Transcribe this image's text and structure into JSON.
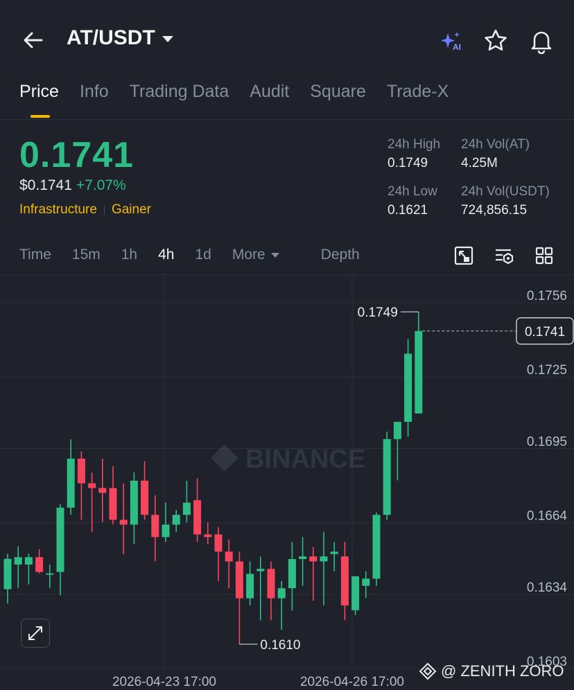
{
  "header": {
    "pair": "AT/USDT",
    "icons": [
      "back-arrow-icon",
      "ai-sparkle-icon",
      "star-icon",
      "bell-icon"
    ]
  },
  "tabs": [
    {
      "label": "Price",
      "active": true
    },
    {
      "label": "Info",
      "active": false
    },
    {
      "label": "Trading Data",
      "active": false
    },
    {
      "label": "Audit",
      "active": false
    },
    {
      "label": "Square",
      "active": false
    },
    {
      "label": "Trade-X",
      "active": false
    }
  ],
  "price": {
    "last": "0.1741",
    "usd": "$0.1741",
    "change": "+7.07%",
    "tags": [
      "Infrastructure",
      "Gainer"
    ]
  },
  "stats": {
    "high_label": "24h High",
    "high": "0.1749",
    "low_label": "24h Low",
    "low": "0.1621",
    "vol_base_label": "24h Vol(AT)",
    "vol_base": "4.25M",
    "vol_quote_label": "24h Vol(USDT)",
    "vol_quote": "724,856.15"
  },
  "intervals": {
    "items": [
      "Time",
      "15m",
      "1h",
      "4h",
      "1d"
    ],
    "active": "4h",
    "more": "More",
    "depth": "Depth"
  },
  "chart_data": {
    "type": "candlestick",
    "interval": "4h",
    "watermark": "BINANCE",
    "y_ticks": [
      "0.1756",
      "0.1725",
      "0.1695",
      "0.1664",
      "0.1634",
      "0.1603"
    ],
    "x_ticks": [
      "2026-04-23 17:00",
      "2026-04-26 17:00"
    ],
    "last_price": "0.1741",
    "max_label": "0.1749",
    "min_label": "0.1610",
    "colors": {
      "up": "#2ebd85",
      "down": "#f6465d",
      "grid": "#2b2f36",
      "text": "#b7bdc6"
    },
    "candles": [
      {
        "o": 0.1633,
        "h": 0.16478,
        "l": 0.1627,
        "c": 0.16457
      },
      {
        "o": 0.16433,
        "h": 0.16509,
        "l": 0.16335,
        "c": 0.16464
      },
      {
        "o": 0.16433,
        "h": 0.16478,
        "l": 0.1635,
        "c": 0.16464
      },
      {
        "o": 0.16464,
        "h": 0.16498,
        "l": 0.16396,
        "c": 0.16402
      },
      {
        "o": 0.16396,
        "h": 0.16433,
        "l": 0.16335,
        "c": 0.16396
      },
      {
        "o": 0.16402,
        "h": 0.16685,
        "l": 0.16305,
        "c": 0.16671
      },
      {
        "o": 0.16671,
        "h": 0.16957,
        "l": 0.16641,
        "c": 0.16876
      },
      {
        "o": 0.16876,
        "h": 0.16906,
        "l": 0.1662,
        "c": 0.16773
      },
      {
        "o": 0.16773,
        "h": 0.16818,
        "l": 0.16569,
        "c": 0.16753
      },
      {
        "o": 0.16753,
        "h": 0.16876,
        "l": 0.1661,
        "c": 0.16733
      },
      {
        "o": 0.16753,
        "h": 0.16845,
        "l": 0.166,
        "c": 0.1662
      },
      {
        "o": 0.1662,
        "h": 0.16773,
        "l": 0.16476,
        "c": 0.166
      },
      {
        "o": 0.166,
        "h": 0.16819,
        "l": 0.16518,
        "c": 0.16784
      },
      {
        "o": 0.16784,
        "h": 0.16866,
        "l": 0.1662,
        "c": 0.16641
      },
      {
        "o": 0.16641,
        "h": 0.16723,
        "l": 0.16447,
        "c": 0.16548
      },
      {
        "o": 0.16548,
        "h": 0.16692,
        "l": 0.16528,
        "c": 0.166
      },
      {
        "o": 0.166,
        "h": 0.16661,
        "l": 0.1657,
        "c": 0.16641
      },
      {
        "o": 0.16641,
        "h": 0.16784,
        "l": 0.1661,
        "c": 0.16692
      },
      {
        "o": 0.16702,
        "h": 0.16794,
        "l": 0.16528,
        "c": 0.16559
      },
      {
        "o": 0.16559,
        "h": 0.1661,
        "l": 0.16518,
        "c": 0.16548
      },
      {
        "o": 0.16559,
        "h": 0.1659,
        "l": 0.16364,
        "c": 0.16487
      },
      {
        "o": 0.16487,
        "h": 0.16538,
        "l": 0.16333,
        "c": 0.16446
      },
      {
        "o": 0.16446,
        "h": 0.16487,
        "l": 0.161,
        "c": 0.16292
      },
      {
        "o": 0.16292,
        "h": 0.16446,
        "l": 0.16262,
        "c": 0.16394
      },
      {
        "o": 0.16405,
        "h": 0.16466,
        "l": 0.162,
        "c": 0.16415
      },
      {
        "o": 0.16415,
        "h": 0.16446,
        "l": 0.162,
        "c": 0.16292
      },
      {
        "o": 0.16292,
        "h": 0.16364,
        "l": 0.1616,
        "c": 0.16334
      },
      {
        "o": 0.16334,
        "h": 0.16528,
        "l": 0.16241,
        "c": 0.16456
      },
      {
        "o": 0.16456,
        "h": 0.16548,
        "l": 0.16344,
        "c": 0.16467
      },
      {
        "o": 0.16467,
        "h": 0.16507,
        "l": 0.16282,
        "c": 0.16446
      },
      {
        "o": 0.16446,
        "h": 0.16569,
        "l": 0.16262,
        "c": 0.16467
      },
      {
        "o": 0.16477,
        "h": 0.16528,
        "l": 0.16405,
        "c": 0.16487
      },
      {
        "o": 0.16467,
        "h": 0.16528,
        "l": 0.162,
        "c": 0.16262
      },
      {
        "o": 0.16242,
        "h": 0.16384,
        "l": 0.16221,
        "c": 0.16384
      },
      {
        "o": 0.16344,
        "h": 0.16405,
        "l": 0.16293,
        "c": 0.16374
      },
      {
        "o": 0.16374,
        "h": 0.16651,
        "l": 0.16344,
        "c": 0.16641
      },
      {
        "o": 0.16641,
        "h": 0.16989,
        "l": 0.1662,
        "c": 0.16958
      },
      {
        "o": 0.16958,
        "h": 0.1703,
        "l": 0.16785,
        "c": 0.1703
      },
      {
        "o": 0.1703,
        "h": 0.17376,
        "l": 0.16968,
        "c": 0.17315
      },
      {
        "o": 0.17065,
        "h": 0.1749,
        "l": 0.17065,
        "c": 0.1741
      }
    ]
  },
  "watermark_credit": "@ ZENITH ZORO"
}
